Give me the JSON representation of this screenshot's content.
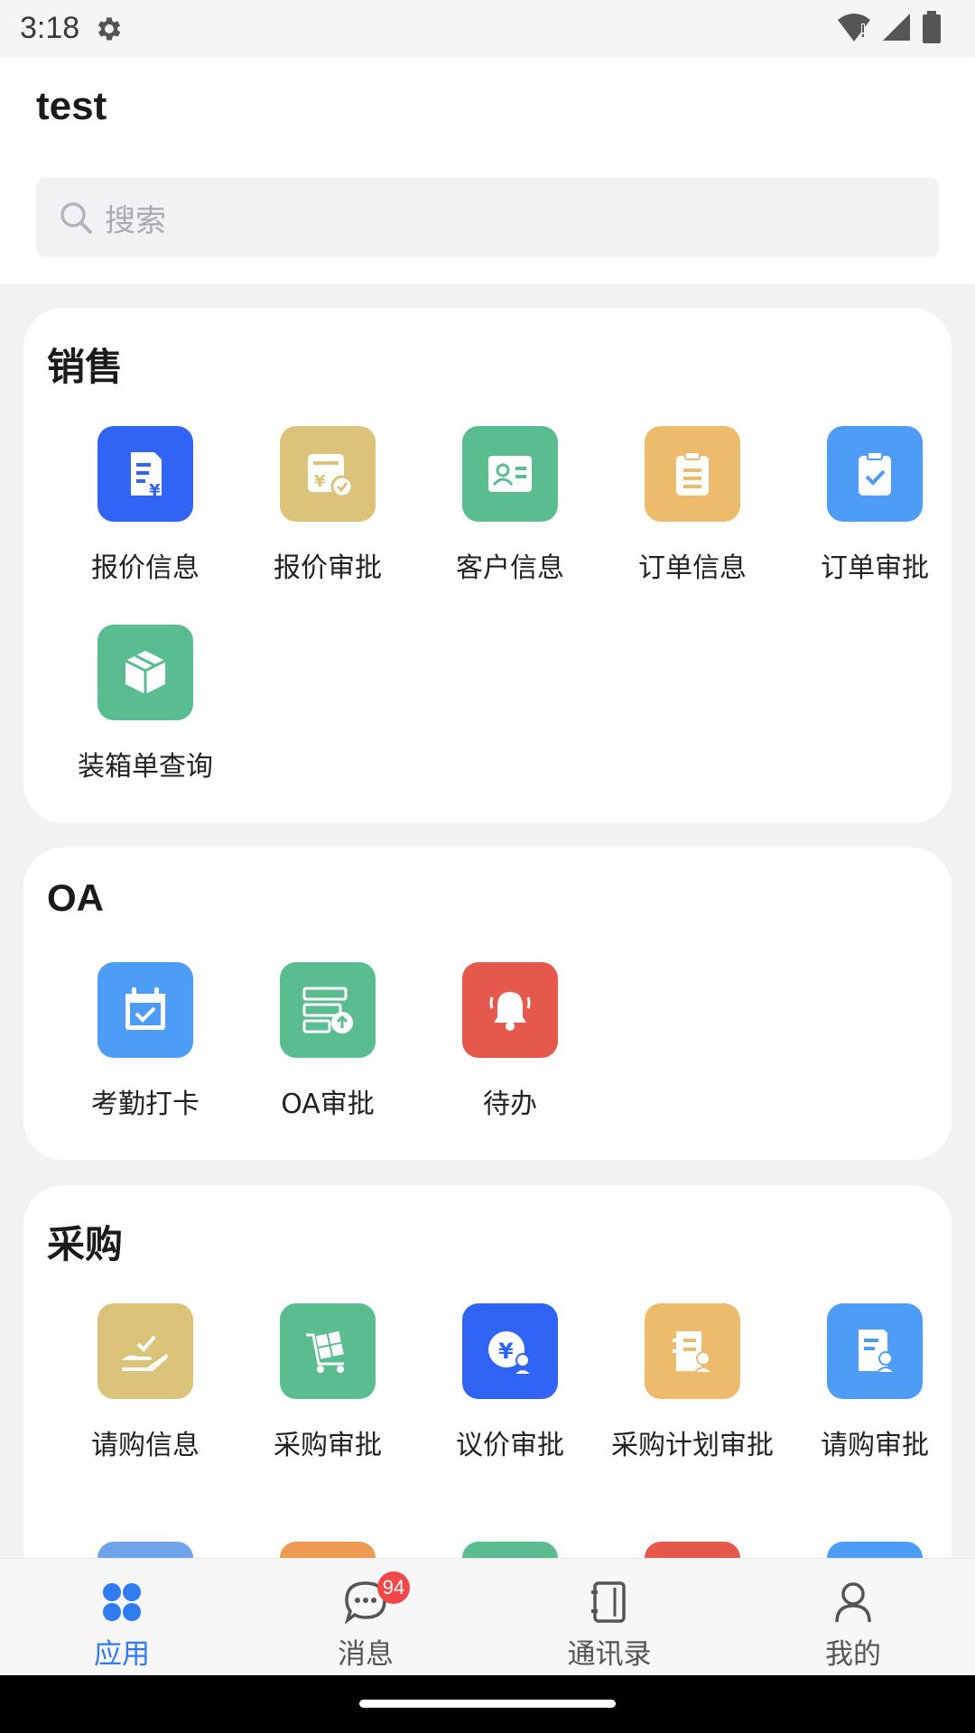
{
  "status": {
    "time": "3:18"
  },
  "header": {
    "title": "test",
    "search_placeholder": "搜索"
  },
  "colors": {
    "accent": "#2f7bf0",
    "badge": "#f04848"
  },
  "sections": [
    {
      "title": "销售",
      "items": [
        {
          "label": "报价信息",
          "icon": "quote-doc-icon",
          "color": "#2f64f5"
        },
        {
          "label": "报价审批",
          "icon": "quote-approve-icon",
          "color": "#dcc37a"
        },
        {
          "label": "客户信息",
          "icon": "customer-card-icon",
          "color": "#59bd8f"
        },
        {
          "label": "订单信息",
          "icon": "clipboard-icon",
          "color": "#ecbb6c"
        },
        {
          "label": "订单审批",
          "icon": "clipboard-check-icon",
          "color": "#4d9cf6"
        },
        {
          "label": "装箱单查询",
          "icon": "box-icon",
          "color": "#59bd8f"
        }
      ]
    },
    {
      "title": "OA",
      "items": [
        {
          "label": "考勤打卡",
          "icon": "calendar-check-icon",
          "color": "#4d9cf6"
        },
        {
          "label": "OA审批",
          "icon": "form-upload-icon",
          "color": "#59bd8f"
        },
        {
          "label": "待办",
          "icon": "bell-icon",
          "color": "#e5594c"
        }
      ]
    },
    {
      "title": "采购",
      "items": [
        {
          "label": "请购信息",
          "icon": "hand-check-icon",
          "color": "#dcc37a"
        },
        {
          "label": "采购审批",
          "icon": "cart-icon",
          "color": "#59bd8f"
        },
        {
          "label": "议价审批",
          "icon": "price-person-icon",
          "color": "#2f64f5"
        },
        {
          "label": "采购计划审批",
          "icon": "plan-person-icon",
          "color": "#ecbb6c"
        },
        {
          "label": "请购审批",
          "icon": "doc-person-icon",
          "color": "#4d9cf6"
        }
      ],
      "more_row_colors": [
        "#6ea5ea",
        "#ef9a52",
        "#59bd8f",
        "#e5594c",
        "#4d9cf6"
      ]
    }
  ],
  "tabs": [
    {
      "label": "应用",
      "icon": "apps-icon",
      "active": true
    },
    {
      "label": "消息",
      "icon": "chat-icon",
      "badge": "94"
    },
    {
      "label": "通讯录",
      "icon": "contacts-book-icon"
    },
    {
      "label": "我的",
      "icon": "user-icon"
    }
  ]
}
